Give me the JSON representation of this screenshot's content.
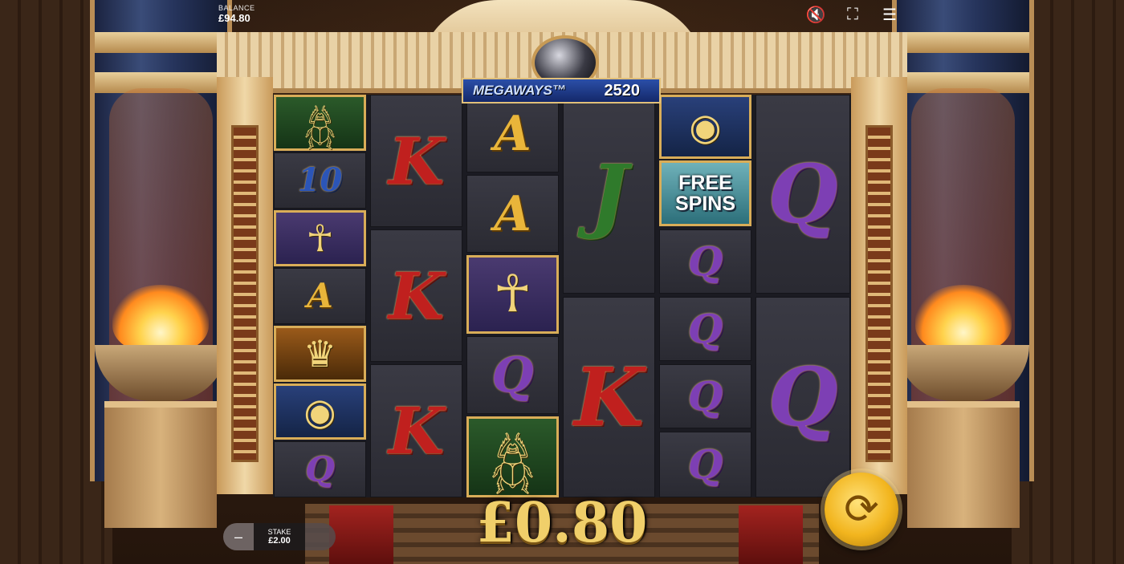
{
  "balance": {
    "label": "BALANCE",
    "value": "£94.80"
  },
  "top_icons": [
    "mute-icon",
    "fullscreen-icon",
    "menu-icon"
  ],
  "megaways": {
    "label": "MEGAWAYS™",
    "value": "2520"
  },
  "win_amount": "£0.80",
  "stake": {
    "label": "STAKE",
    "value": "£2.00",
    "minus": "–"
  },
  "free_spins": {
    "line1": "FREE",
    "line2": "SPINS"
  },
  "reels": [
    {
      "symbols": [
        "scarab",
        "10",
        "ankh",
        "A",
        "pharaoh",
        "eye",
        "Q"
      ]
    },
    {
      "symbols": [
        "K",
        "K",
        "K"
      ]
    },
    {
      "symbols": [
        "A",
        "A",
        "ankh",
        "Q",
        "scarab"
      ]
    },
    {
      "symbols": [
        "J",
        "K"
      ]
    },
    {
      "symbols": [
        "eye",
        "free-spins",
        "Q",
        "Q",
        "Q",
        "Q"
      ]
    },
    {
      "symbols": [
        "Q",
        "Q"
      ]
    }
  ],
  "glyphs": {
    "scarab": "𓆣",
    "ankh": "☥",
    "pharaoh": "♛",
    "eye": "◉",
    "mute": "🔇",
    "fullscreen": "⛶",
    "menu": "☰",
    "spin": "⟳"
  }
}
